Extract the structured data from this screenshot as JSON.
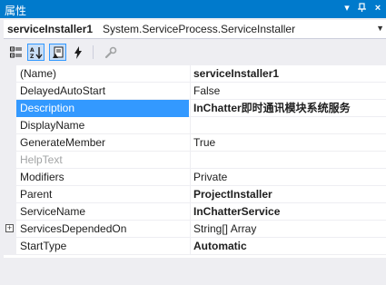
{
  "window": {
    "title": "属性",
    "controls": {
      "dropdown": "▾",
      "pin": "⊣",
      "close": "×"
    }
  },
  "object_selector": {
    "name": "serviceInstaller1",
    "type": "System.ServiceProcess.ServiceInstaller"
  },
  "toolbar": {
    "buttons": [
      {
        "icon": "categorized-icon",
        "active": false
      },
      {
        "icon": "alphabetical-icon",
        "active": true
      },
      {
        "icon": "properties-icon",
        "active": true
      },
      {
        "icon": "events-icon",
        "active": false
      },
      {
        "icon": "property-pages-icon",
        "active": false
      }
    ]
  },
  "properties": [
    {
      "name": "(Name)",
      "value": "serviceInstaller1",
      "bold": true
    },
    {
      "name": "DelayedAutoStart",
      "value": "False",
      "bold": false
    },
    {
      "name": "Description",
      "value": "InChatter即时通讯模块系统服务",
      "bold": true,
      "selected": true
    },
    {
      "name": "DisplayName",
      "value": "",
      "bold": false
    },
    {
      "name": "GenerateMember",
      "value": "True",
      "bold": false
    },
    {
      "name": "HelpText",
      "value": "",
      "bold": false,
      "disabled": true
    },
    {
      "name": "Modifiers",
      "value": "Private",
      "bold": false
    },
    {
      "name": "Parent",
      "value": "ProjectInstaller",
      "bold": true
    },
    {
      "name": "ServiceName",
      "value": "InChatterService",
      "bold": true
    },
    {
      "name": "ServicesDependedOn",
      "value": "String[] Array",
      "bold": false,
      "expandable": true,
      "expander": "+"
    },
    {
      "name": "StartType",
      "value": "Automatic",
      "bold": true
    }
  ],
  "colors": {
    "accent": "#007ACC",
    "selection": "#3399FF",
    "panel": "#EEEEF2"
  }
}
